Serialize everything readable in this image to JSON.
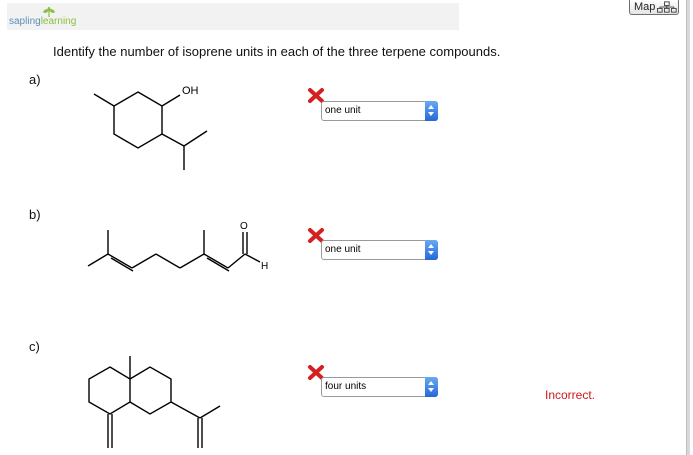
{
  "header": {
    "logo_word1": "sapling",
    "logo_word2": "learning",
    "map_label": "Map"
  },
  "question": {
    "text": "Identify the number of isoprene units in each of the three terpene compounds."
  },
  "parts": [
    {
      "label": "a)",
      "atom_labels": [
        "OH"
      ],
      "status": "incorrect",
      "selected": "one unit"
    },
    {
      "label": "b)",
      "atom_labels": [
        "O",
        "H"
      ],
      "status": "incorrect",
      "selected": "one unit"
    },
    {
      "label": "c)",
      "atom_labels": [],
      "status": "incorrect",
      "selected": "four units"
    }
  ],
  "feedback": {
    "text": "Incorrect."
  },
  "colors": {
    "incorrect_red": "#cc1b1b",
    "select_arrow_blue": "#2e74dc",
    "logo_blue": "#5a8fb8",
    "logo_green": "#8cbf3f"
  }
}
